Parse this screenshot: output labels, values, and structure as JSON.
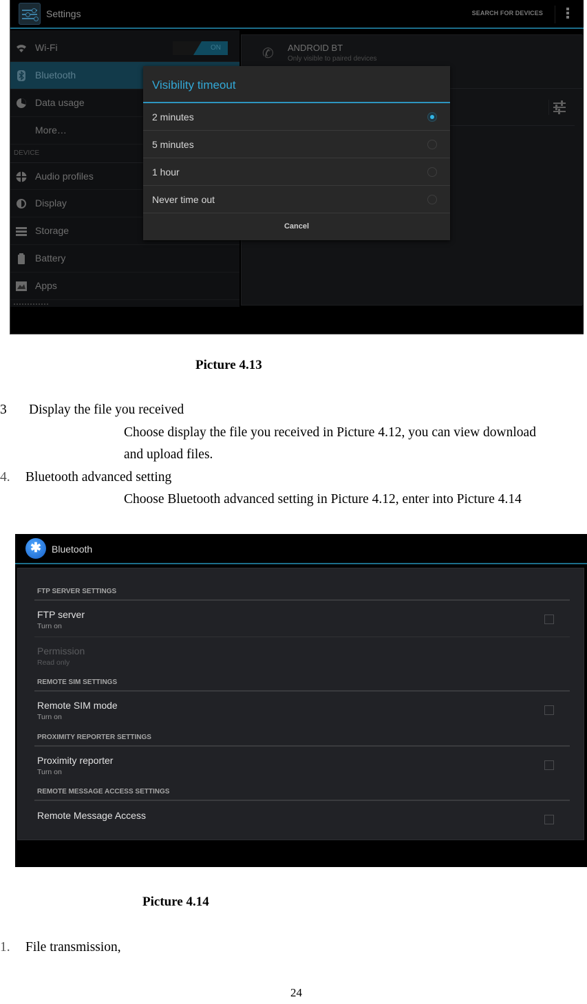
{
  "picture_4_13": {
    "app_title": "Settings",
    "action_search": "SEARCH FOR DEVICES",
    "left_menu": {
      "items": [
        {
          "label": "Wi-Fi",
          "icon": "wifi-icon",
          "toggle": "ON"
        },
        {
          "label": "Bluetooth",
          "icon": "bluetooth-icon",
          "active": true
        },
        {
          "label": "Data usage",
          "icon": "data-usage-icon"
        },
        {
          "label": "More…"
        }
      ],
      "section_device": "DEVICE",
      "device_items": [
        {
          "label": "Audio profiles",
          "icon": "audio-profiles-icon"
        },
        {
          "label": "Display",
          "icon": "display-icon"
        },
        {
          "label": "Storage",
          "icon": "storage-icon"
        },
        {
          "label": "Battery",
          "icon": "battery-icon"
        },
        {
          "label": "Apps",
          "icon": "apps-icon"
        }
      ]
    },
    "device": {
      "name": "ANDROID BT",
      "subtitle": "Only visible to paired devices"
    },
    "dialog": {
      "title": "Visibility timeout",
      "options": [
        {
          "label": "2 minutes",
          "selected": true
        },
        {
          "label": "5 minutes",
          "selected": false
        },
        {
          "label": "1 hour",
          "selected": false
        },
        {
          "label": "Never time out",
          "selected": false
        }
      ],
      "cancel": "Cancel"
    },
    "accent_color": "#33b5e5"
  },
  "doc": {
    "caption_1": "Picture 4.13",
    "item3_num": "3",
    "item3_title": "Display the file you received",
    "item3_body_line1": "Choose display the file you received in Picture 4.12, you can view download",
    "item3_body_line2": "and upload files.",
    "item4_num": "4.",
    "item4_title": "Bluetooth advanced setting",
    "item4_body": "Choose Bluetooth advanced setting in Picture 4.12, enter into Picture 4.14",
    "caption_2": "Picture 4.14",
    "item1_num": "1.",
    "item1_title": "File transmission,",
    "page_number": "24"
  },
  "picture_4_14": {
    "app_title": "Bluetooth",
    "sections": [
      {
        "header": "FTP SERVER SETTINGS",
        "items": [
          {
            "title": "FTP server",
            "summary": "Turn on",
            "checkbox": true,
            "checked": false
          },
          {
            "title": "Permission",
            "summary": "Read only",
            "disabled": true
          }
        ]
      },
      {
        "header": "REMOTE SIM SETTINGS",
        "items": [
          {
            "title": "Remote SIM mode",
            "summary": "Turn on",
            "checkbox": true,
            "checked": false
          }
        ]
      },
      {
        "header": "PROXIMITY REPORTER SETTINGS",
        "items": [
          {
            "title": "Proximity reporter",
            "summary": "Turn on",
            "checkbox": true,
            "checked": false
          }
        ]
      },
      {
        "header": "REMOTE MESSAGE ACCESS SETTINGS",
        "items": [
          {
            "title": "Remote Message Access",
            "checkbox": true,
            "checked": false
          }
        ]
      }
    ]
  }
}
